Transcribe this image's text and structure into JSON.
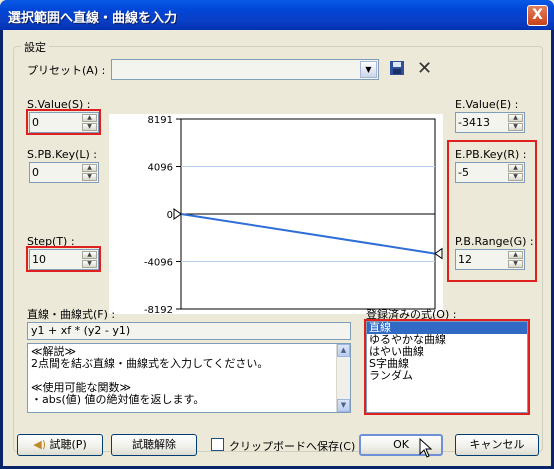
{
  "window": {
    "title": "選択範囲へ直線・曲線を入力",
    "close_label": "X"
  },
  "group": {
    "label": "設定"
  },
  "preset": {
    "label": "プリセット(A) :",
    "value": "",
    "save_icon": "floppy-save-icon",
    "delete_icon": "x-delete-icon"
  },
  "left": {
    "s_value": {
      "label": "S.Value(S) :",
      "value": "0"
    },
    "s_pb_key": {
      "label": "S.PB.Key(L) :",
      "value": "0"
    },
    "step": {
      "label": "Step(T) :",
      "value": "10"
    }
  },
  "right": {
    "e_value": {
      "label": "E.Value(E) :",
      "value": "-3413"
    },
    "e_pb_key": {
      "label": "E.PB.Key(R) :",
      "value": "-5"
    },
    "pb_range": {
      "label": "P.B.Range(G) :",
      "value": "12"
    }
  },
  "chart_data": {
    "type": "line",
    "y_ticks": [
      "8191",
      "4096",
      "0",
      "-4096",
      "-8192"
    ],
    "ylim": [
      -8192,
      8191
    ],
    "series": [
      {
        "x": [
          0,
          1
        ],
        "y": [
          0,
          -3413
        ]
      }
    ],
    "grid": true,
    "colors": {
      "line": "#2d6fd6",
      "grid": "#b8d0ee",
      "zero": "#000000"
    }
  },
  "formula": {
    "label": "直線・曲線式(F) :",
    "value": "y1 + xf * (y2 - y1)",
    "description": [
      "≪解説≫",
      "2点間を結ぶ直線・曲線式を入力してください。",
      "",
      "≪使用可能な関数≫",
      "・abs(値)  値の絶対値を返します。"
    ]
  },
  "registered": {
    "label": "登録済みの式(O) :",
    "items": [
      "直線",
      "ゆるやかな曲線",
      "はやい曲線",
      "S字曲線",
      "ランダム"
    ],
    "selected_index": 0
  },
  "buttons": {
    "preview": "試聴(P)",
    "preview_cancel": "試聴解除",
    "clipboard": "クリップボードへ保存(C)",
    "ok": "OK",
    "cancel": "キャンセル"
  },
  "colors": {
    "highlight": "#e02020",
    "selection": "#316ac5"
  }
}
